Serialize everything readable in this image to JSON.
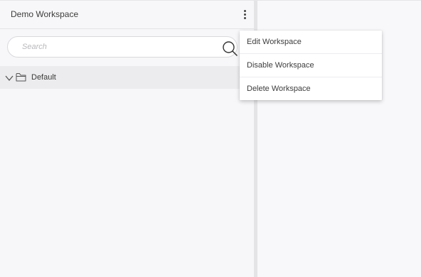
{
  "workspace": {
    "title": "Demo Workspace"
  },
  "search": {
    "placeholder": "Search",
    "value": ""
  },
  "tree": {
    "items": [
      {
        "label": "Default",
        "expanded": true,
        "icon": "folder-icon"
      }
    ]
  },
  "menu": {
    "items": [
      {
        "label": "Edit Workspace"
      },
      {
        "label": "Disable Workspace"
      },
      {
        "label": "Delete Workspace"
      }
    ]
  }
}
